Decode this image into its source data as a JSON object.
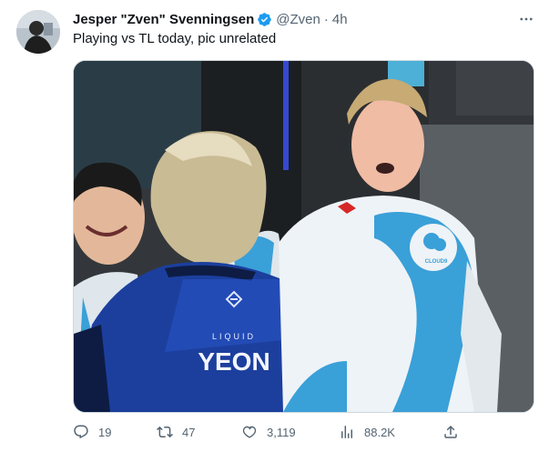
{
  "tweet": {
    "author": {
      "display_name": "Jesper \"Zven\" Svenningsen",
      "handle": "@Zven",
      "verified": true
    },
    "separator": "·",
    "time": "4h",
    "text": "Playing vs TL today, pic unrelated",
    "image": {
      "jersey_text_brand": "LIQUID",
      "jersey_text_name": "YEON",
      "sponsor_logo_text": "CLOUD9"
    },
    "actions": {
      "replies": "19",
      "retweets": "47",
      "likes": "3,119",
      "views": "88.2K"
    }
  },
  "colors": {
    "verified": "#1d9bf0",
    "secondary_text": "#536471",
    "liquid_blue": "#1c3f9e",
    "cloud9_blue": "#3aa0d8"
  },
  "icons": {
    "more": "more-icon",
    "reply": "reply-icon",
    "retweet": "retweet-icon",
    "like": "like-icon",
    "views": "views-icon",
    "share": "share-icon"
  }
}
